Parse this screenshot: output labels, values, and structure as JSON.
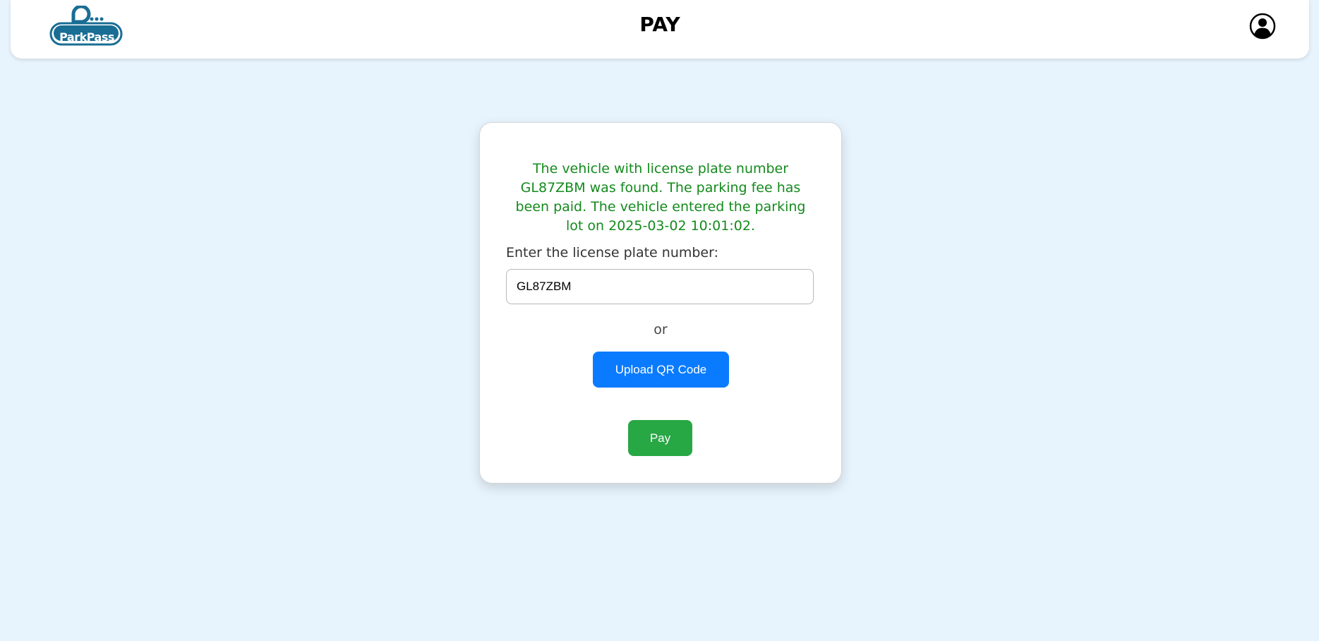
{
  "header": {
    "logo_text": "ParkPass",
    "title": "PAY",
    "profile_icon": "user-circle-icon"
  },
  "colors": {
    "page_background": "#e8f4fd",
    "success_text": "#138a1c",
    "upload_button": "#0a7bff",
    "pay_button": "#28a745",
    "logo": "#1a6d94"
  },
  "form": {
    "message": "The vehicle with license plate number GL87ZBM was found. The parking fee has been paid. The vehicle entered the parking lot on 2025-03-02 10:01:02.",
    "plate_label": "Enter the license plate number:",
    "plate_value": "GL87ZBM",
    "or_text": "or",
    "upload_label": "Upload QR Code",
    "pay_label": "Pay"
  }
}
